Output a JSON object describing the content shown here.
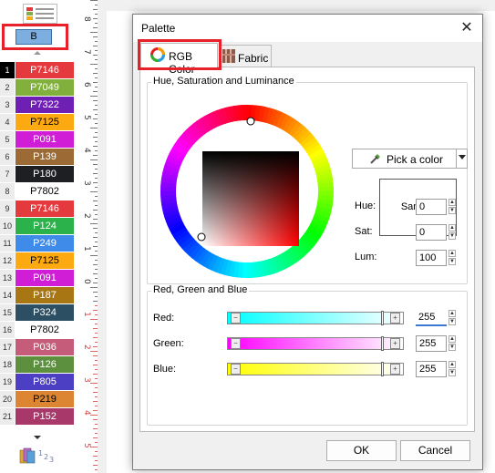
{
  "left_panel": {
    "selected_button": "B",
    "rows": [
      {
        "n": "1",
        "label": "P7146",
        "bg": "#e4393d",
        "fg": "#ffffff",
        "sel": true
      },
      {
        "n": "2",
        "label": "P7049",
        "bg": "#82b03c",
        "fg": "#ffffff"
      },
      {
        "n": "3",
        "label": "P7322",
        "bg": "#6e1fb4",
        "fg": "#ffffff"
      },
      {
        "n": "4",
        "label": "P7125",
        "bg": "#fca912",
        "fg": "#000000"
      },
      {
        "n": "5",
        "label": "P091",
        "bg": "#d01dd6",
        "fg": "#ffffff"
      },
      {
        "n": "6",
        "label": "P139",
        "bg": "#9c6a35",
        "fg": "#ffffff"
      },
      {
        "n": "7",
        "label": "P180",
        "bg": "#1e1f22",
        "fg": "#ffffff"
      },
      {
        "n": "8",
        "label": "P7802",
        "bg": "#ffffff",
        "fg": "#000000"
      },
      {
        "n": "9",
        "label": "P7146",
        "bg": "#e4393d",
        "fg": "#ffffff"
      },
      {
        "n": "10",
        "label": "P124",
        "bg": "#2cb24a",
        "fg": "#ffffff"
      },
      {
        "n": "11",
        "label": "P249",
        "bg": "#3f8bea",
        "fg": "#ffffff"
      },
      {
        "n": "12",
        "label": "P7125",
        "bg": "#fca912",
        "fg": "#000000"
      },
      {
        "n": "13",
        "label": "P091",
        "bg": "#d01dd6",
        "fg": "#ffffff"
      },
      {
        "n": "14",
        "label": "P187",
        "bg": "#a87714",
        "fg": "#ffffff"
      },
      {
        "n": "15",
        "label": "P324",
        "bg": "#2d4f63",
        "fg": "#ffffff"
      },
      {
        "n": "16",
        "label": "P7802",
        "bg": "#ffffff",
        "fg": "#000000"
      },
      {
        "n": "17",
        "label": "P036",
        "bg": "#c55c7a",
        "fg": "#ffffff"
      },
      {
        "n": "18",
        "label": "P126",
        "bg": "#5c8f3e",
        "fg": "#ffffff"
      },
      {
        "n": "19",
        "label": "P805",
        "bg": "#4d3fc4",
        "fg": "#ffffff"
      },
      {
        "n": "20",
        "label": "P219",
        "bg": "#dc8532",
        "fg": "#000000"
      },
      {
        "n": "21",
        "label": "P152",
        "bg": "#a8386a",
        "fg": "#ffffff"
      }
    ]
  },
  "ruler": {
    "ticks": [
      "8",
      "7",
      "6",
      "5",
      "4",
      "3",
      "2",
      "1",
      "0",
      "1",
      "2",
      "3",
      "4",
      "5"
    ]
  },
  "dialog": {
    "title": "Palette",
    "close": "✕",
    "tabs": [
      {
        "label": "RGB Color",
        "active": true
      },
      {
        "label": "Fabric",
        "active": false
      }
    ],
    "hsl_group": {
      "title": "Hue, Saturation and Luminance",
      "pick_button": "Pick a color",
      "sample_label": "Sample",
      "fields": [
        {
          "label": "Hue:",
          "value": "0"
        },
        {
          "label": "Sat:",
          "value": "0"
        },
        {
          "label": "Lum:",
          "value": "100"
        }
      ]
    },
    "rgb_group": {
      "title": "Red, Green and Blue",
      "channels": [
        {
          "label": "Red:",
          "value": "255",
          "grad": "linear-gradient(to right,#00ffff,#ffffff)"
        },
        {
          "label": "Green:",
          "value": "255",
          "grad": "linear-gradient(to right,#ff00ff,#ffffff)"
        },
        {
          "label": "Blue:",
          "value": "255",
          "grad": "linear-gradient(to right,#ffff00,#ffffff)"
        }
      ]
    },
    "ok": "OK",
    "cancel": "Cancel"
  },
  "colors": {
    "highlight_red": "#e8202a",
    "selected_blue": "#7cafe0"
  }
}
